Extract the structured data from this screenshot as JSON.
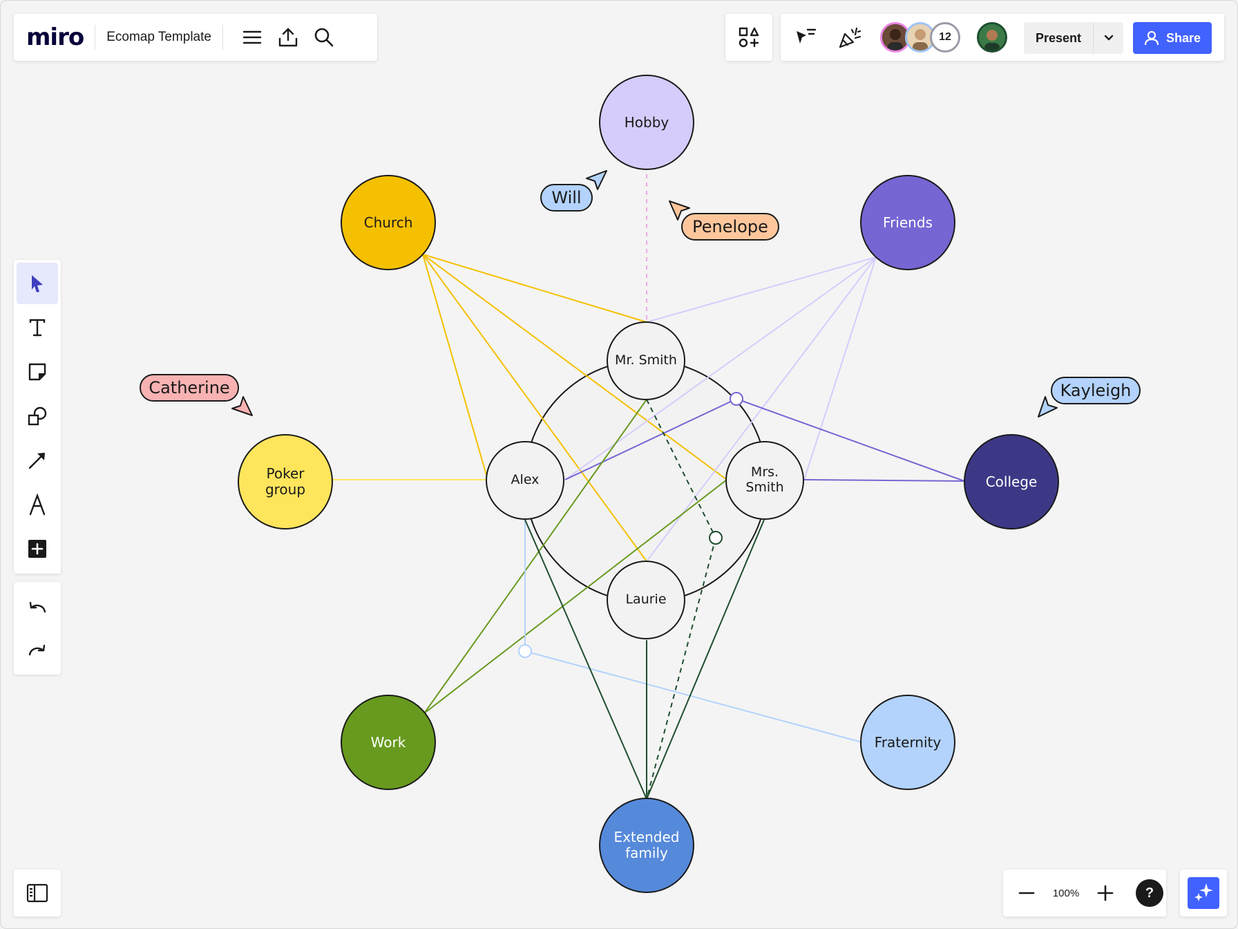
{
  "app": {
    "logo": "miro",
    "board_title": "Ecomap Template"
  },
  "header": {
    "icons": [
      "menu-icon",
      "export-icon",
      "search-icon"
    ],
    "apps_icon": "shapes-plus-icon",
    "collab_icons": [
      "cursor-follow-icon",
      "celebrate-icon"
    ],
    "collaborator_count": "12",
    "present_label": "Present",
    "share_label": "Share"
  },
  "toolbar": {
    "tools": [
      "select-tool",
      "text-tool",
      "sticky-note-tool",
      "shapes-tool",
      "connector-tool",
      "pen-tool",
      "add-more-tool"
    ],
    "active_tool": "select-tool",
    "history": [
      "undo",
      "redo"
    ]
  },
  "canvas": {
    "nodes": {
      "hobby": "Hobby",
      "church": "Church",
      "friends": "Friends",
      "poker": "Poker group",
      "college": "College",
      "work": "Work",
      "fraternity": "Fraternity",
      "extended": "Extended family",
      "mr_smith": "Mr. Smith",
      "mrs_smith": "Mrs. Smith",
      "alex": "Alex",
      "laurie": "Laurie"
    },
    "colors": {
      "hobby": "#d6ccfc",
      "church": "#f5c000",
      "friends": "#7566d3",
      "poker": "#ffe55c",
      "college": "#3d3886",
      "work": "#679a1e",
      "fraternity": "#b3d3fd",
      "extended": "#5589da",
      "family": "#f2f2f2"
    },
    "cursors": {
      "will": "Will",
      "penelope": "Penelope",
      "catherine": "Catherine",
      "kayleigh": "Kayleigh"
    },
    "cursor_colors": {
      "will": "#b3d3fd",
      "penelope": "#ffc69c",
      "catherine": "#f9b2b2",
      "kayleigh": "#b3d3fd"
    }
  },
  "footer": {
    "zoom_level": "100%",
    "help": "?"
  }
}
